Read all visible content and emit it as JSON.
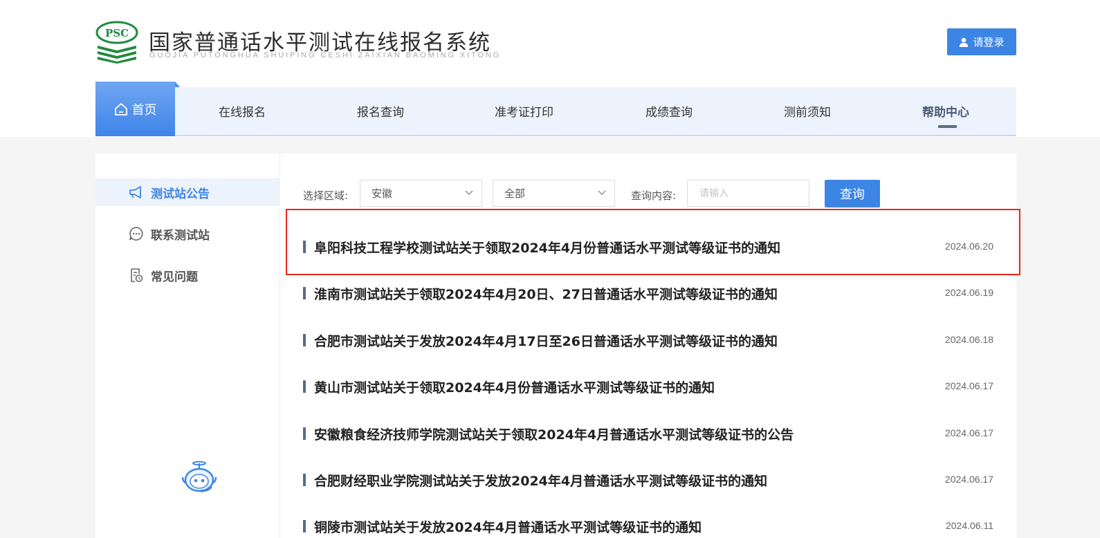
{
  "header": {
    "title": "国家普通话水平测试在线报名系统",
    "subtitle": "GUOJIA PUTONGHUA SHUIPING CESHI ZAIXIAN BAOMING XITONG",
    "logo_text": "PSC",
    "login_label": "请登录"
  },
  "nav": {
    "home": "首页",
    "items": [
      "在线报名",
      "报名查询",
      "准考证打印",
      "成绩查询",
      "测前须知",
      "帮助中心"
    ]
  },
  "sidebar": {
    "items": [
      {
        "label": "测试站公告",
        "icon": "megaphone-icon"
      },
      {
        "label": "联系测试站",
        "icon": "chat-icon"
      },
      {
        "label": "常见问题",
        "icon": "faq-document-icon"
      }
    ]
  },
  "filters": {
    "region_label": "选择区域:",
    "region_value": "安徽",
    "scope_value": "全部",
    "query_label": "查询内容:",
    "query_placeholder": "请输入",
    "search_button": "查询"
  },
  "news": [
    {
      "title": "阜阳科技工程学校测试站关于领取2024年4月份普通话水平测试等级证书的通知",
      "date": "2024.06.20"
    },
    {
      "title": "淮南市测试站关于领取2024年4月20日、27日普通话水平测试等级证书的通知",
      "date": "2024.06.19"
    },
    {
      "title": "合肥市测试站关于发放2024年4月17日至26日普通话水平测试等级证书的通知",
      "date": "2024.06.18"
    },
    {
      "title": "黄山市测试站关于领取2024年4月份普通话水平测试等级证书的通知",
      "date": "2024.06.17"
    },
    {
      "title": "安徽粮食经济技师学院测试站关于领取2024年4月普通话水平测试等级证书的公告",
      "date": "2024.06.17"
    },
    {
      "title": "合肥财经职业学院测试站关于发放2024年4月普通话水平测试等级证书的通知",
      "date": "2024.06.17"
    },
    {
      "title": "铜陵市测试站关于发放2024年4月普通话水平测试等级证书的通知",
      "date": "2024.06.11"
    }
  ],
  "colors": {
    "primary": "#3d85e4",
    "logo_green": "#1f8a3c",
    "highlight": "#e8261a"
  }
}
